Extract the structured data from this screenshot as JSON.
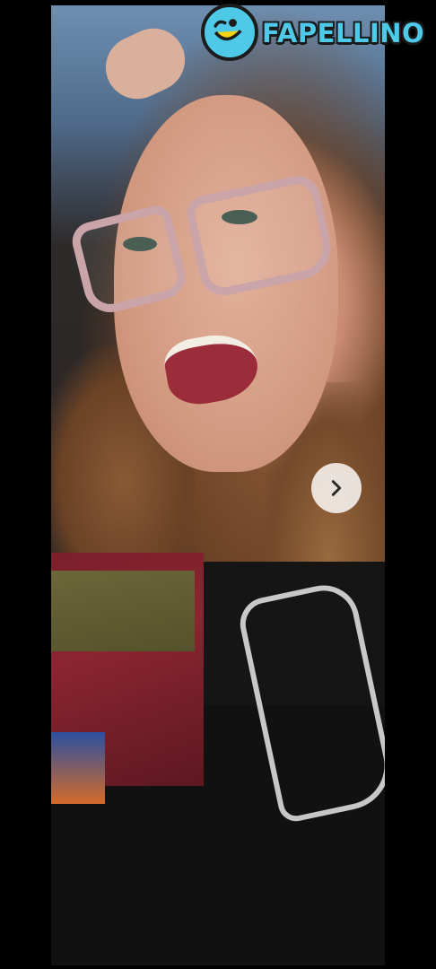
{
  "logo": {
    "text": "FAPELLINO",
    "icon": "smiley-face-icon",
    "color": "#4ec9e8"
  },
  "gallery": {
    "next_icon": "chevron-right-icon"
  }
}
